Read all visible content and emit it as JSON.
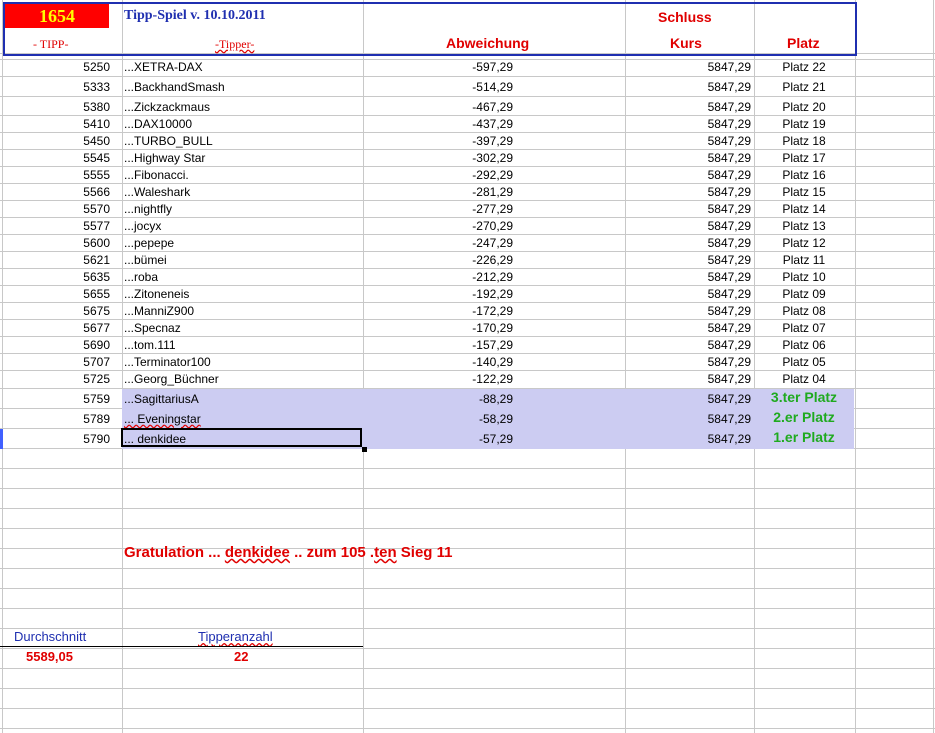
{
  "header": {
    "count": "1654",
    "title": "Tipp-Spiel v. 10.10.2011",
    "schluss": "Schluss",
    "col_tipp": "- TIPP-",
    "col_tipper": "-Tipper-",
    "col_abweichung": "Abweichung",
    "col_kurs": "Kurs",
    "col_platz": "Platz"
  },
  "rows": [
    {
      "tipp": "5250",
      "name": "...XETRA-DAX",
      "abw": "-597,29",
      "kurs": "5847,29",
      "platz": "Platz 22"
    },
    {
      "tipp": "5333",
      "name": "...BackhandSmash",
      "abw": "-514,29",
      "kurs": "5847,29",
      "platz": "Platz 21"
    },
    {
      "tipp": "5380",
      "name": "...Zickzackmaus",
      "abw": "-467,29",
      "kurs": "5847,29",
      "platz": "Platz 20"
    },
    {
      "tipp": "5410",
      "name": "...DAX10000",
      "abw": "-437,29",
      "kurs": "5847,29",
      "platz": "Platz 19"
    },
    {
      "tipp": "5450",
      "name": "...TURBO_BULL",
      "abw": "-397,29",
      "kurs": "5847,29",
      "platz": "Platz 18"
    },
    {
      "tipp": "5545",
      "name": "...Highway Star",
      "abw": "-302,29",
      "kurs": "5847,29",
      "platz": "Platz 17"
    },
    {
      "tipp": "5555",
      "name": "...Fibonacci.",
      "abw": "-292,29",
      "kurs": "5847,29",
      "platz": "Platz 16"
    },
    {
      "tipp": "5566",
      "name": "...Waleshark",
      "abw": "-281,29",
      "kurs": "5847,29",
      "platz": "Platz 15"
    },
    {
      "tipp": "5570",
      "name": "...nightfly",
      "abw": "-277,29",
      "kurs": "5847,29",
      "platz": "Platz 14"
    },
    {
      "tipp": "5577",
      "name": "...jocyx",
      "abw": "-270,29",
      "kurs": "5847,29",
      "platz": "Platz 13"
    },
    {
      "tipp": "5600",
      "name": "...pepepe",
      "abw": "-247,29",
      "kurs": "5847,29",
      "platz": "Platz 12"
    },
    {
      "tipp": "5621",
      "name": "...bümei",
      "abw": "-226,29",
      "kurs": "5847,29",
      "platz": "Platz 11"
    },
    {
      "tipp": "5635",
      "name": "...roba",
      "abw": "-212,29",
      "kurs": "5847,29",
      "platz": "Platz 10"
    },
    {
      "tipp": "5655",
      "name": "...Zitoneneis",
      "abw": "-192,29",
      "kurs": "5847,29",
      "platz": "Platz 09"
    },
    {
      "tipp": "5675",
      "name": "...ManniZ900",
      "abw": "-172,29",
      "kurs": "5847,29",
      "platz": "Platz 08"
    },
    {
      "tipp": "5677",
      "name": "...Specnaz",
      "abw": "-170,29",
      "kurs": "5847,29",
      "platz": "Platz 07"
    },
    {
      "tipp": "5690",
      "name": "...tom.111",
      "abw": "-157,29",
      "kurs": "5847,29",
      "platz": "Platz 06"
    },
    {
      "tipp": "5707",
      "name": "...Terminator100",
      "abw": "-140,29",
      "kurs": "5847,29",
      "platz": "Platz 05"
    },
    {
      "tipp": "5725",
      "name": "...Georg_Büchner",
      "abw": "-122,29",
      "kurs": "5847,29",
      "platz": "Platz 04"
    }
  ],
  "top3": [
    {
      "tipp": "5759",
      "name": "...SagittariusA",
      "abw": "-88,29",
      "kurs": "5847,29",
      "platz": "3.ter Platz"
    },
    {
      "tipp": "5789",
      "name": "... Eveningstar",
      "abw": "-58,29",
      "kurs": "5847,29",
      "platz": "2.er Platz"
    },
    {
      "tipp": "5790",
      "name": "... denkidee",
      "abw": "-57,29",
      "kurs": "5847,29",
      "platz": "1.er Platz"
    }
  ],
  "gratulation": {
    "prefix": "Gratulation  ...",
    "winner": "denkidee",
    "middle": ".. zum 105 .",
    "ten": "ten",
    "suffix": "Sieg 11"
  },
  "stats": {
    "durchschnitt_label": "Durchschnitt",
    "durchschnitt_value": "5589,05",
    "tipperanzahl_label": "Tipperanzahl",
    "tipperanzahl_value": "22"
  },
  "colors": {
    "header_border": "#1f2fb0",
    "badge_bg": "#ff0000",
    "badge_text": "#ffff00",
    "accent_red": "#e00000",
    "green": "#1faa1f",
    "highlight": "#ccccf2"
  }
}
